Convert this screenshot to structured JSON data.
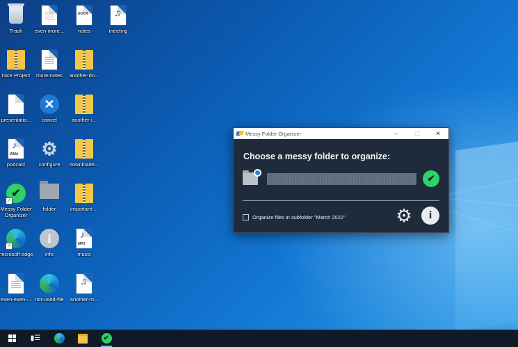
{
  "desktop": {
    "icons": [
      {
        "label": "Trash",
        "kind": "trash-icon"
      },
      {
        "label": "even-more...",
        "kind": "text-document-icon"
      },
      {
        "label": "notes",
        "kind": "docx-document-icon",
        "tag": "DOCX"
      },
      {
        "label": "meeting",
        "kind": "audio-file-icon"
      },
      {
        "label": "Nice Project",
        "kind": "folder-icon"
      },
      {
        "label": "more-notes",
        "kind": "text-document-icon"
      },
      {
        "label": "another-do...",
        "kind": "zip-folder-icon"
      },
      {
        "label": "presentatio...",
        "kind": "text-document-icon"
      },
      {
        "label": "cancel",
        "kind": "cancel-icon"
      },
      {
        "label": "another-i...",
        "kind": "zip-folder-icon"
      },
      {
        "label": "podcast",
        "kind": "wma-file-icon",
        "tag": "WMA"
      },
      {
        "label": "configure",
        "kind": "gear-icon"
      },
      {
        "label": "downloade...",
        "kind": "zip-folder-icon"
      },
      {
        "label": "Messy Folder Organizer",
        "kind": "app-shortcut-icon"
      },
      {
        "label": "folder",
        "kind": "folder-icon"
      },
      {
        "label": "important-...",
        "kind": "zip-folder-icon"
      },
      {
        "label": "microsoft edge",
        "kind": "edge-icon"
      },
      {
        "label": "info",
        "kind": "info-icon"
      },
      {
        "label": "music",
        "kind": "mp3-file-icon",
        "tag": "MP3"
      },
      {
        "label": "even-even-...",
        "kind": "text-document-icon"
      },
      {
        "label": "not-used-file",
        "kind": "edge-icon"
      },
      {
        "label": "another-m...",
        "kind": "audio-file-icon"
      }
    ]
  },
  "window": {
    "title": "Messy Folder Organizer",
    "controls": {
      "minimize": "–",
      "maximize": "☐",
      "close": "✕"
    },
    "heading": "Choose a messy folder to organize:",
    "path_value": "",
    "confirm_icon": "checkmark-icon",
    "option_label": "Organize files in subfolder \"March 2022\"",
    "option_checked": false,
    "settings_icon": "gear-icon",
    "info_icon": "info-icon"
  },
  "taskbar": {
    "items": [
      "start-button",
      "task-view",
      "edge",
      "file-explorer",
      "messy-folder-organizer"
    ]
  },
  "colors": {
    "window_bg": "#1f2b3a",
    "accent_green": "#2fd16a",
    "taskbar_bg": "#0f1a26"
  }
}
